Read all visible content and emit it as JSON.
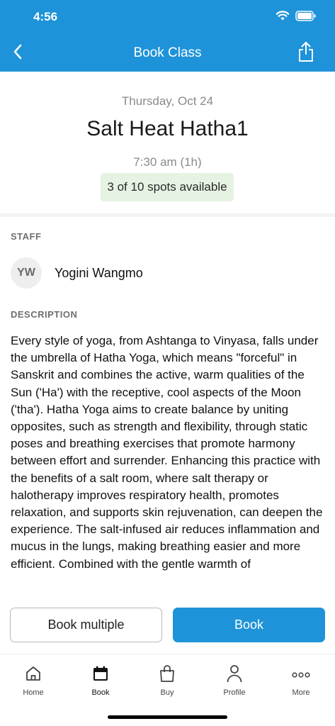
{
  "status_bar": {
    "time": "4:56"
  },
  "nav": {
    "title": "Book Class"
  },
  "class_info": {
    "date": "Thursday, Oct 24",
    "name": "Salt Heat Hatha1",
    "time": "7:30 am (1h)",
    "availability": "3 of 10 spots available"
  },
  "staff": {
    "section_label": "STAFF",
    "initials": "YW",
    "name": "Yogini Wangmo"
  },
  "description": {
    "section_label": "DESCRIPTION",
    "text": "Every style of yoga, from Ashtanga to Vinyasa, falls under the umbrella of Hatha Yoga, which means \"forceful\" in Sanskrit and combines the active, warm qualities of the Sun ('Ha') with the receptive, cool aspects of the Moon ('tha'). Hatha Yoga aims to create balance by uniting opposites, such as strength and flexibility, through static poses and breathing exercises that promote harmony between effort and surrender. Enhancing this practice with the benefits of a salt room, where salt therapy or halotherapy improves respiratory health, promotes relaxation, and supports skin rejuvenation, can deepen the experience. The salt-infused air reduces inflammation and mucus in the lungs, making breathing easier and more efficient. Combined with the gentle warmth of"
  },
  "actions": {
    "book_multiple_label": "Book multiple",
    "book_label": "Book"
  },
  "tabbar": {
    "items": [
      {
        "label": "Home",
        "icon": "home-icon"
      },
      {
        "label": "Book",
        "icon": "calendar-icon"
      },
      {
        "label": "Buy",
        "icon": "shopping-bag-icon"
      },
      {
        "label": "Profile",
        "icon": "user-icon"
      },
      {
        "label": "More",
        "icon": "more-icon"
      }
    ],
    "active": "Book"
  },
  "colors": {
    "accent": "#1e93d9",
    "badge_bg": "#e6f3e3"
  }
}
